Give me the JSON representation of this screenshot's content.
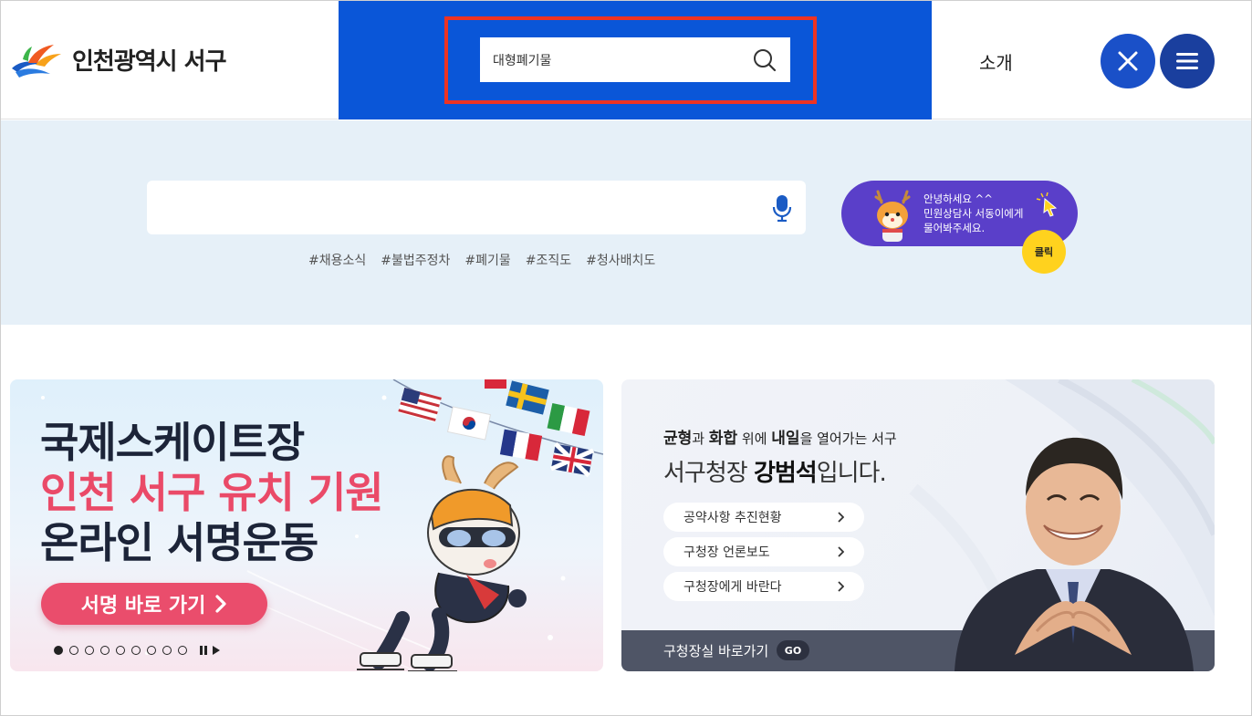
{
  "header": {
    "logo_text": "인천광역시 서구",
    "search_value": "대형폐기물",
    "nav_intro": "소개"
  },
  "search_band": {
    "main_search_value": "",
    "tags": [
      "#채용소식",
      "#불법주정차",
      "#폐기물",
      "#조직도",
      "#청사배치도"
    ],
    "chatbot": {
      "line1": "안녕하세요 ^^",
      "line2": "민원상담사 서동이에게",
      "line3": "물어봐주세요.",
      "click_label": "클릭"
    }
  },
  "banner_left": {
    "line1": "국제스케이트장",
    "line2": "인천 서구 유치 기원",
    "line3": "온라인 서명운동",
    "button_label": "서명 바로 가기",
    "slide_count": 9,
    "active_slide": 1
  },
  "banner_right": {
    "slogan_w1": "균형",
    "slogan_s1": "과 ",
    "slogan_w2": "화합",
    "slogan_s2": " 위에 ",
    "slogan_w3": "내일",
    "slogan_s3": "을 열어가는 서구",
    "title_prefix": "서구청장 ",
    "title_name": "강범석",
    "title_suffix": "입니다.",
    "links": [
      "공약사항 추진현황",
      "구청장 언론보도",
      "구청장에게 바란다"
    ],
    "footer_label": "구청장실 바로가기",
    "footer_badge": "GO"
  },
  "colors": {
    "header_blue": "#0a56d8",
    "highlight_red": "#ee3322",
    "band_bg": "#e6f0f8",
    "chatbot_purple": "#5a3fc9",
    "accent_pink": "#ea4a68"
  }
}
